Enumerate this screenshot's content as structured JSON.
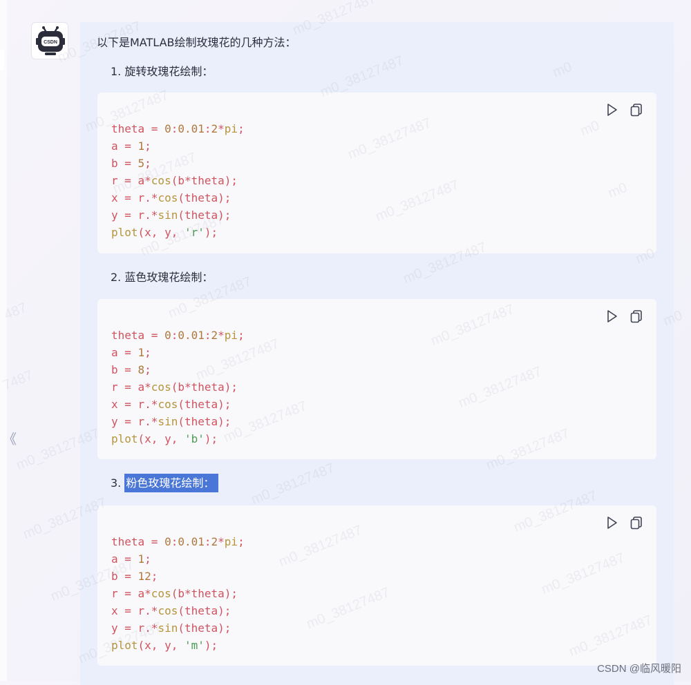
{
  "sidebar": {
    "collapse_glyph": "《"
  },
  "assistant": {
    "avatar_icon": "csdn-robot-icon",
    "avatar_text": "CSDN"
  },
  "message": {
    "intro": "以下是MATLAB绘制玫瑰花的几种方法：",
    "items": [
      {
        "title_number": "1. ",
        "title_text": "旋转玫瑰花绘制：",
        "selected": false,
        "code_lines": [
          "theta = 0:0.01:2*pi;",
          "a = 1;",
          "b = 5;",
          "r = a*cos(b*theta);",
          "x = r.*cos(theta);",
          "y = r.*sin(theta);",
          "plot(x, y, 'r');"
        ]
      },
      {
        "title_number": "2. ",
        "title_text": "蓝色玫瑰花绘制：",
        "selected": false,
        "code_lines": [
          "theta = 0:0.01:2*pi;",
          "a = 1;",
          "b = 8;",
          "r = a*cos(b*theta);",
          "x = r.*cos(theta);",
          "y = r.*sin(theta);",
          "plot(x, y, 'b');"
        ]
      },
      {
        "title_number": "3. ",
        "title_text": "粉色玫瑰花绘制：",
        "selected": true,
        "code_lines": [
          "theta = 0:0.01:2*pi;",
          "a = 1;",
          "b = 12;",
          "r = a*cos(b*theta);",
          "x = r.*cos(theta);",
          "y = r.*sin(theta);",
          "plot(x, y, 'm');"
        ]
      }
    ],
    "code_tools": {
      "run_icon": "play-icon",
      "copy_icon": "copy-icon"
    }
  },
  "watermark": {
    "text": "m0_38127487",
    "partial_texts": [
      "m0",
      "487",
      "7487"
    ]
  },
  "footer": {
    "credit": "CSDN @临风暖阳"
  },
  "colors": {
    "bubble_bg": "#eaeffb",
    "code_bg": "#f9f9fc",
    "selection": "#4a76d8",
    "code_default": "#d0525e",
    "code_number": "#b0773b",
    "code_function": "#b6943a",
    "code_string": "#4b9a54"
  }
}
